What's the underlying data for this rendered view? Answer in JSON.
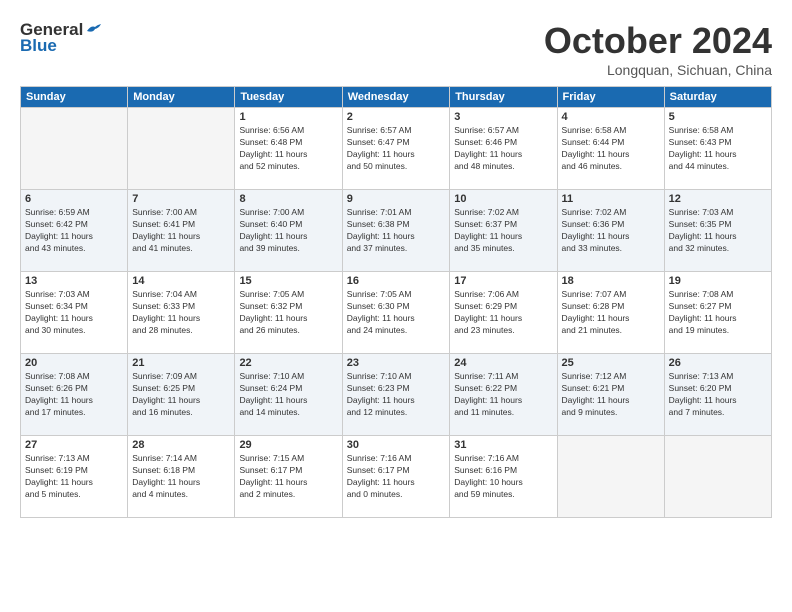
{
  "logo": {
    "line1": "General",
    "line2": "Blue"
  },
  "title": "October 2024",
  "subtitle": "Longquan, Sichuan, China",
  "weekdays": [
    "Sunday",
    "Monday",
    "Tuesday",
    "Wednesday",
    "Thursday",
    "Friday",
    "Saturday"
  ],
  "weeks": [
    [
      {
        "day": "",
        "info": ""
      },
      {
        "day": "",
        "info": ""
      },
      {
        "day": "1",
        "info": "Sunrise: 6:56 AM\nSunset: 6:48 PM\nDaylight: 11 hours\nand 52 minutes."
      },
      {
        "day": "2",
        "info": "Sunrise: 6:57 AM\nSunset: 6:47 PM\nDaylight: 11 hours\nand 50 minutes."
      },
      {
        "day": "3",
        "info": "Sunrise: 6:57 AM\nSunset: 6:46 PM\nDaylight: 11 hours\nand 48 minutes."
      },
      {
        "day": "4",
        "info": "Sunrise: 6:58 AM\nSunset: 6:44 PM\nDaylight: 11 hours\nand 46 minutes."
      },
      {
        "day": "5",
        "info": "Sunrise: 6:58 AM\nSunset: 6:43 PM\nDaylight: 11 hours\nand 44 minutes."
      }
    ],
    [
      {
        "day": "6",
        "info": "Sunrise: 6:59 AM\nSunset: 6:42 PM\nDaylight: 11 hours\nand 43 minutes."
      },
      {
        "day": "7",
        "info": "Sunrise: 7:00 AM\nSunset: 6:41 PM\nDaylight: 11 hours\nand 41 minutes."
      },
      {
        "day": "8",
        "info": "Sunrise: 7:00 AM\nSunset: 6:40 PM\nDaylight: 11 hours\nand 39 minutes."
      },
      {
        "day": "9",
        "info": "Sunrise: 7:01 AM\nSunset: 6:38 PM\nDaylight: 11 hours\nand 37 minutes."
      },
      {
        "day": "10",
        "info": "Sunrise: 7:02 AM\nSunset: 6:37 PM\nDaylight: 11 hours\nand 35 minutes."
      },
      {
        "day": "11",
        "info": "Sunrise: 7:02 AM\nSunset: 6:36 PM\nDaylight: 11 hours\nand 33 minutes."
      },
      {
        "day": "12",
        "info": "Sunrise: 7:03 AM\nSunset: 6:35 PM\nDaylight: 11 hours\nand 32 minutes."
      }
    ],
    [
      {
        "day": "13",
        "info": "Sunrise: 7:03 AM\nSunset: 6:34 PM\nDaylight: 11 hours\nand 30 minutes."
      },
      {
        "day": "14",
        "info": "Sunrise: 7:04 AM\nSunset: 6:33 PM\nDaylight: 11 hours\nand 28 minutes."
      },
      {
        "day": "15",
        "info": "Sunrise: 7:05 AM\nSunset: 6:32 PM\nDaylight: 11 hours\nand 26 minutes."
      },
      {
        "day": "16",
        "info": "Sunrise: 7:05 AM\nSunset: 6:30 PM\nDaylight: 11 hours\nand 24 minutes."
      },
      {
        "day": "17",
        "info": "Sunrise: 7:06 AM\nSunset: 6:29 PM\nDaylight: 11 hours\nand 23 minutes."
      },
      {
        "day": "18",
        "info": "Sunrise: 7:07 AM\nSunset: 6:28 PM\nDaylight: 11 hours\nand 21 minutes."
      },
      {
        "day": "19",
        "info": "Sunrise: 7:08 AM\nSunset: 6:27 PM\nDaylight: 11 hours\nand 19 minutes."
      }
    ],
    [
      {
        "day": "20",
        "info": "Sunrise: 7:08 AM\nSunset: 6:26 PM\nDaylight: 11 hours\nand 17 minutes."
      },
      {
        "day": "21",
        "info": "Sunrise: 7:09 AM\nSunset: 6:25 PM\nDaylight: 11 hours\nand 16 minutes."
      },
      {
        "day": "22",
        "info": "Sunrise: 7:10 AM\nSunset: 6:24 PM\nDaylight: 11 hours\nand 14 minutes."
      },
      {
        "day": "23",
        "info": "Sunrise: 7:10 AM\nSunset: 6:23 PM\nDaylight: 11 hours\nand 12 minutes."
      },
      {
        "day": "24",
        "info": "Sunrise: 7:11 AM\nSunset: 6:22 PM\nDaylight: 11 hours\nand 11 minutes."
      },
      {
        "day": "25",
        "info": "Sunrise: 7:12 AM\nSunset: 6:21 PM\nDaylight: 11 hours\nand 9 minutes."
      },
      {
        "day": "26",
        "info": "Sunrise: 7:13 AM\nSunset: 6:20 PM\nDaylight: 11 hours\nand 7 minutes."
      }
    ],
    [
      {
        "day": "27",
        "info": "Sunrise: 7:13 AM\nSunset: 6:19 PM\nDaylight: 11 hours\nand 5 minutes."
      },
      {
        "day": "28",
        "info": "Sunrise: 7:14 AM\nSunset: 6:18 PM\nDaylight: 11 hours\nand 4 minutes."
      },
      {
        "day": "29",
        "info": "Sunrise: 7:15 AM\nSunset: 6:17 PM\nDaylight: 11 hours\nand 2 minutes."
      },
      {
        "day": "30",
        "info": "Sunrise: 7:16 AM\nSunset: 6:17 PM\nDaylight: 11 hours\nand 0 minutes."
      },
      {
        "day": "31",
        "info": "Sunrise: 7:16 AM\nSunset: 6:16 PM\nDaylight: 10 hours\nand 59 minutes."
      },
      {
        "day": "",
        "info": ""
      },
      {
        "day": "",
        "info": ""
      }
    ]
  ]
}
